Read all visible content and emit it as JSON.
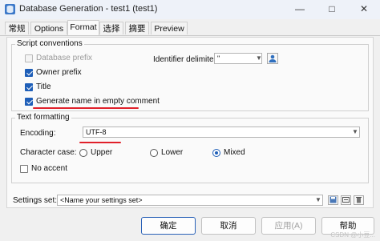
{
  "window": {
    "title": "Database Generation - test1 (test1)",
    "minimize": "—",
    "maximize": "□",
    "close": "✕"
  },
  "tabs": [
    {
      "label": "常规"
    },
    {
      "label": "Options"
    },
    {
      "label": "Format",
      "active": true
    },
    {
      "label": "选择"
    },
    {
      "label": "摘要"
    },
    {
      "label": "Preview"
    }
  ],
  "script_conventions": {
    "legend": "Script conventions",
    "database_prefix": {
      "label": "Database prefix",
      "checked": false,
      "disabled": true
    },
    "owner_prefix": {
      "label": "Owner prefix",
      "checked": true
    },
    "title": {
      "label": "Title",
      "checked": true
    },
    "generate_name": {
      "label": "Generate name in empty comment",
      "checked": true
    },
    "identifier_delimiter": {
      "label": "Identifier delimiter:",
      "value": "\""
    }
  },
  "text_formatting": {
    "legend": "Text formatting",
    "encoding_label": "Encoding:",
    "encoding_value": "UTF-8",
    "character_case_label": "Character case:",
    "case_options": [
      "Upper",
      "Lower",
      "Mixed"
    ],
    "case_selected": "Mixed",
    "no_accent": {
      "label": "No accent",
      "checked": false
    }
  },
  "settings_set": {
    "label": "Settings set:",
    "value": "<Name your settings set>"
  },
  "buttons": {
    "ok": "确定",
    "cancel": "取消",
    "apply": "应用(A)",
    "help": "帮助"
  },
  "watermark": "CSDN @小豆..."
}
